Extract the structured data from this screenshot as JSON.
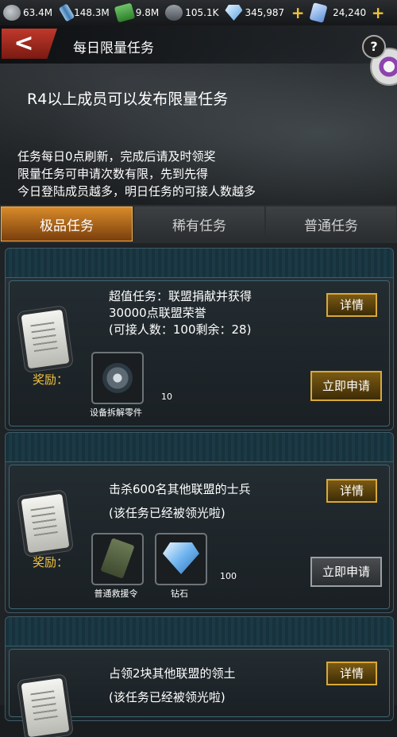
{
  "resources": [
    {
      "icon": "stone-icon",
      "value": "63.4M"
    },
    {
      "icon": "cylinder-icon",
      "value": "148.3M"
    },
    {
      "icon": "cash-icon",
      "value": "9.8M"
    },
    {
      "icon": "oil-icon",
      "value": "105.1K"
    },
    {
      "icon": "diamond-icon",
      "value": "345,987"
    },
    {
      "icon": "card-icon",
      "value": "24,240"
    }
  ],
  "header": {
    "back_label": "<",
    "title": "每日限量任务",
    "help_label": "?"
  },
  "notice": "R4以上成员可以发布限量任务",
  "rules": [
    "任务每日0点刷新，完成后请及时领奖",
    "限量任务可申请次数有限，先到先得",
    "今日登陆成员越多，明日任务的可接人数越多"
  ],
  "tabs": [
    {
      "label": "极品任务",
      "active": true
    },
    {
      "label": "稀有任务",
      "active": false
    },
    {
      "label": "普通任务",
      "active": false
    }
  ],
  "tasks": [
    {
      "title_line1": "超值任务：联盟捐献并获得",
      "title_line2": "30000点联盟荣誉",
      "title_line3": "(可接人数：100剩余：28)",
      "reward_label": "奖励：",
      "detail_label": "详情",
      "apply_label": "立即申请",
      "rewards": [
        {
          "name": "设备拆解零件",
          "qty": "10"
        }
      ]
    },
    {
      "title_line1": "击杀600名其他联盟的士兵",
      "title_line2": "(该任务已经被领光啦)",
      "reward_label": "奖励：",
      "detail_label": "详情",
      "apply_label": "立即申请",
      "rewards": [
        {
          "name": "普通救援令",
          "qty": ""
        },
        {
          "name": "钻石",
          "qty": "100"
        }
      ]
    },
    {
      "title_line1": "占领2块其他联盟的领土",
      "title_line2": "(该任务已经被领光啦)",
      "detail_label": "详情"
    }
  ]
}
